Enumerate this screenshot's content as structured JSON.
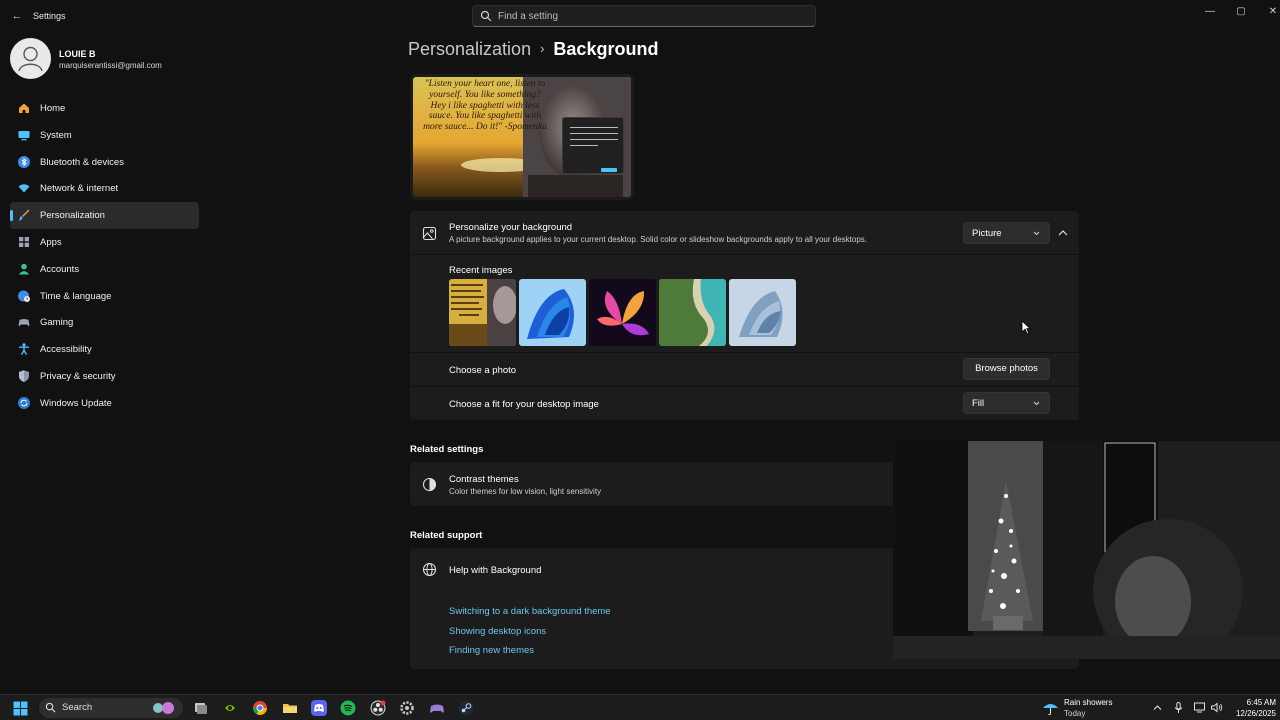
{
  "window": {
    "title": "Settings",
    "search_placeholder": "Find a setting",
    "minimize_glyph": "—",
    "maximize_glyph": "▢",
    "close_glyph": "✕",
    "back_glyph": "←"
  },
  "user": {
    "name": "LOUIE B",
    "email": "marquiserantissi@gmail.com"
  },
  "sidebar": {
    "items": [
      {
        "label": "Home",
        "icon": "home-icon",
        "active": false
      },
      {
        "label": "System",
        "icon": "system-icon",
        "active": false
      },
      {
        "label": "Bluetooth & devices",
        "icon": "bluetooth-icon",
        "active": false
      },
      {
        "label": "Network & internet",
        "icon": "wifi-icon",
        "active": false
      },
      {
        "label": "Personalization",
        "icon": "brush-icon",
        "active": true
      },
      {
        "label": "Apps",
        "icon": "apps-icon",
        "active": false
      },
      {
        "label": "Accounts",
        "icon": "accounts-icon",
        "active": false
      },
      {
        "label": "Time & language",
        "icon": "globe-clock-icon",
        "active": false
      },
      {
        "label": "Gaming",
        "icon": "gamepad-icon",
        "active": false
      },
      {
        "label": "Accessibility",
        "icon": "accessibility-icon",
        "active": false
      },
      {
        "label": "Privacy & security",
        "icon": "shield-icon",
        "active": false
      },
      {
        "label": "Windows Update",
        "icon": "update-icon",
        "active": false
      }
    ]
  },
  "breadcrumb": {
    "parent": "Personalization",
    "separator": "›",
    "current": "Background"
  },
  "preview": {
    "quote": "\"Listen your heart one, listen to yourself. You like something? Hey i like spaghetti with less sauce. You like spaghetti with more sauce... Do it!\" -Spomenka"
  },
  "background": {
    "title": "Personalize your background",
    "description": "A picture background applies to your current desktop. Solid color or slideshow backgrounds apply to all your desktops.",
    "type_value": "Picture",
    "recent_label": "Recent images",
    "recent_thumbs": [
      "quote-wallpaper",
      "blue-bloom",
      "colorful-flower",
      "aerial-coast",
      "glow-bloom"
    ],
    "choose_photo_label": "Choose a photo",
    "browse_label": "Browse photos",
    "fit_label": "Choose a fit for your desktop image",
    "fit_value": "Fill"
  },
  "related_settings": {
    "title": "Related settings",
    "contrast_title": "Contrast themes",
    "contrast_sub": "Color themes for low vision, light sensitivity"
  },
  "related_support": {
    "title": "Related support",
    "help_title": "Help with Background",
    "links": [
      "Switching to a dark background theme",
      "Showing desktop icons",
      "Finding new themes"
    ]
  },
  "taskbar": {
    "search_label": "Search",
    "apps": [
      "widgets-icon",
      "task-view-icon",
      "nvidia-icon",
      "chrome-icon",
      "file-explorer-icon",
      "discord-icon",
      "spotify-icon",
      "obs-icon",
      "settings-icon",
      "controller-app-icon",
      "steam-icon"
    ],
    "weather_main": "Rain showers",
    "weather_sub": "Today",
    "time": "6:45 AM",
    "date": "12/26/2025"
  },
  "colors": {
    "accent": "#4cc2ff",
    "link": "#6cc6f0",
    "card": "#1c1c1c",
    "background": "#111111"
  }
}
